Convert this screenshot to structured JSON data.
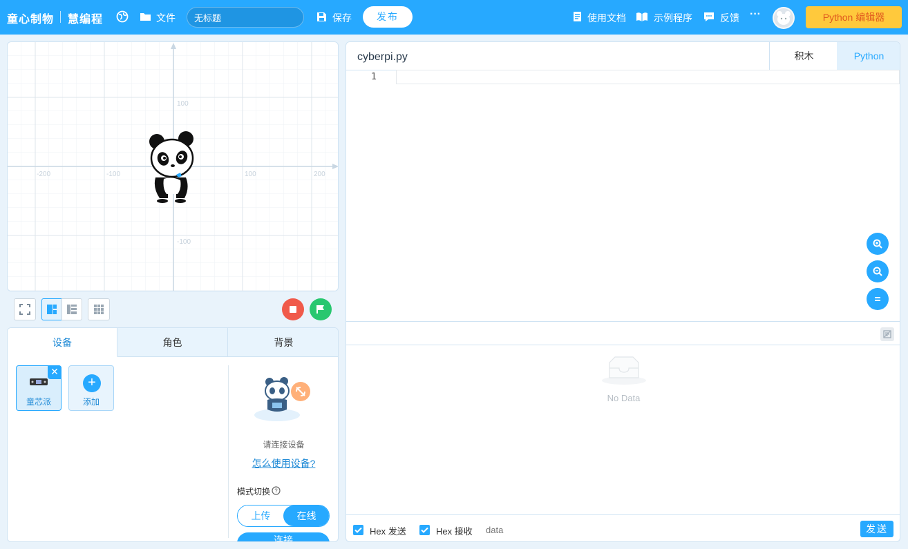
{
  "header": {
    "brand": "童心制物",
    "brand2": "慧编程",
    "file_menu": "文件",
    "project_title": "无标题",
    "save": "保存",
    "publish": "发布",
    "docs": "使用文档",
    "examples": "示例程序",
    "feedback": "反馈",
    "more": "···",
    "editor_mode": "Python 编辑器"
  },
  "stage": {
    "axis_labels": [
      "-200",
      "-100",
      "100",
      "200",
      "100",
      "-100"
    ]
  },
  "panel": {
    "tabs": [
      "设备",
      "角色",
      "背景"
    ],
    "devices": [
      {
        "label": "童芯派",
        "selected": true
      },
      {
        "label": "添加",
        "selected": false
      }
    ],
    "connect_prompt": "请连接设备",
    "how_to_link": "怎么使用设备?",
    "mode_switch_label": "模式切换",
    "mode_upload": "上传",
    "mode_online": "在线",
    "connect_button": "连接"
  },
  "editor": {
    "file_name": "cyberpi.py",
    "tab_blocks": "积木",
    "tab_python": "Python",
    "line_number": "1",
    "no_data": "No Data",
    "hex_send": "Hex 发送",
    "hex_receive": "Hex 接收",
    "send_placeholder": "data",
    "send_button": "发送"
  },
  "colors": {
    "accent": "#27a9ff",
    "stop": "#f05a4a",
    "go": "#28c76f",
    "editor_button": "#ffc93c"
  },
  "icons": {
    "globe": "globe-icon",
    "folder": "folder-icon",
    "save": "floppy-icon",
    "docs": "document-icon",
    "examples": "book-icon",
    "feedback": "chat-icon"
  }
}
